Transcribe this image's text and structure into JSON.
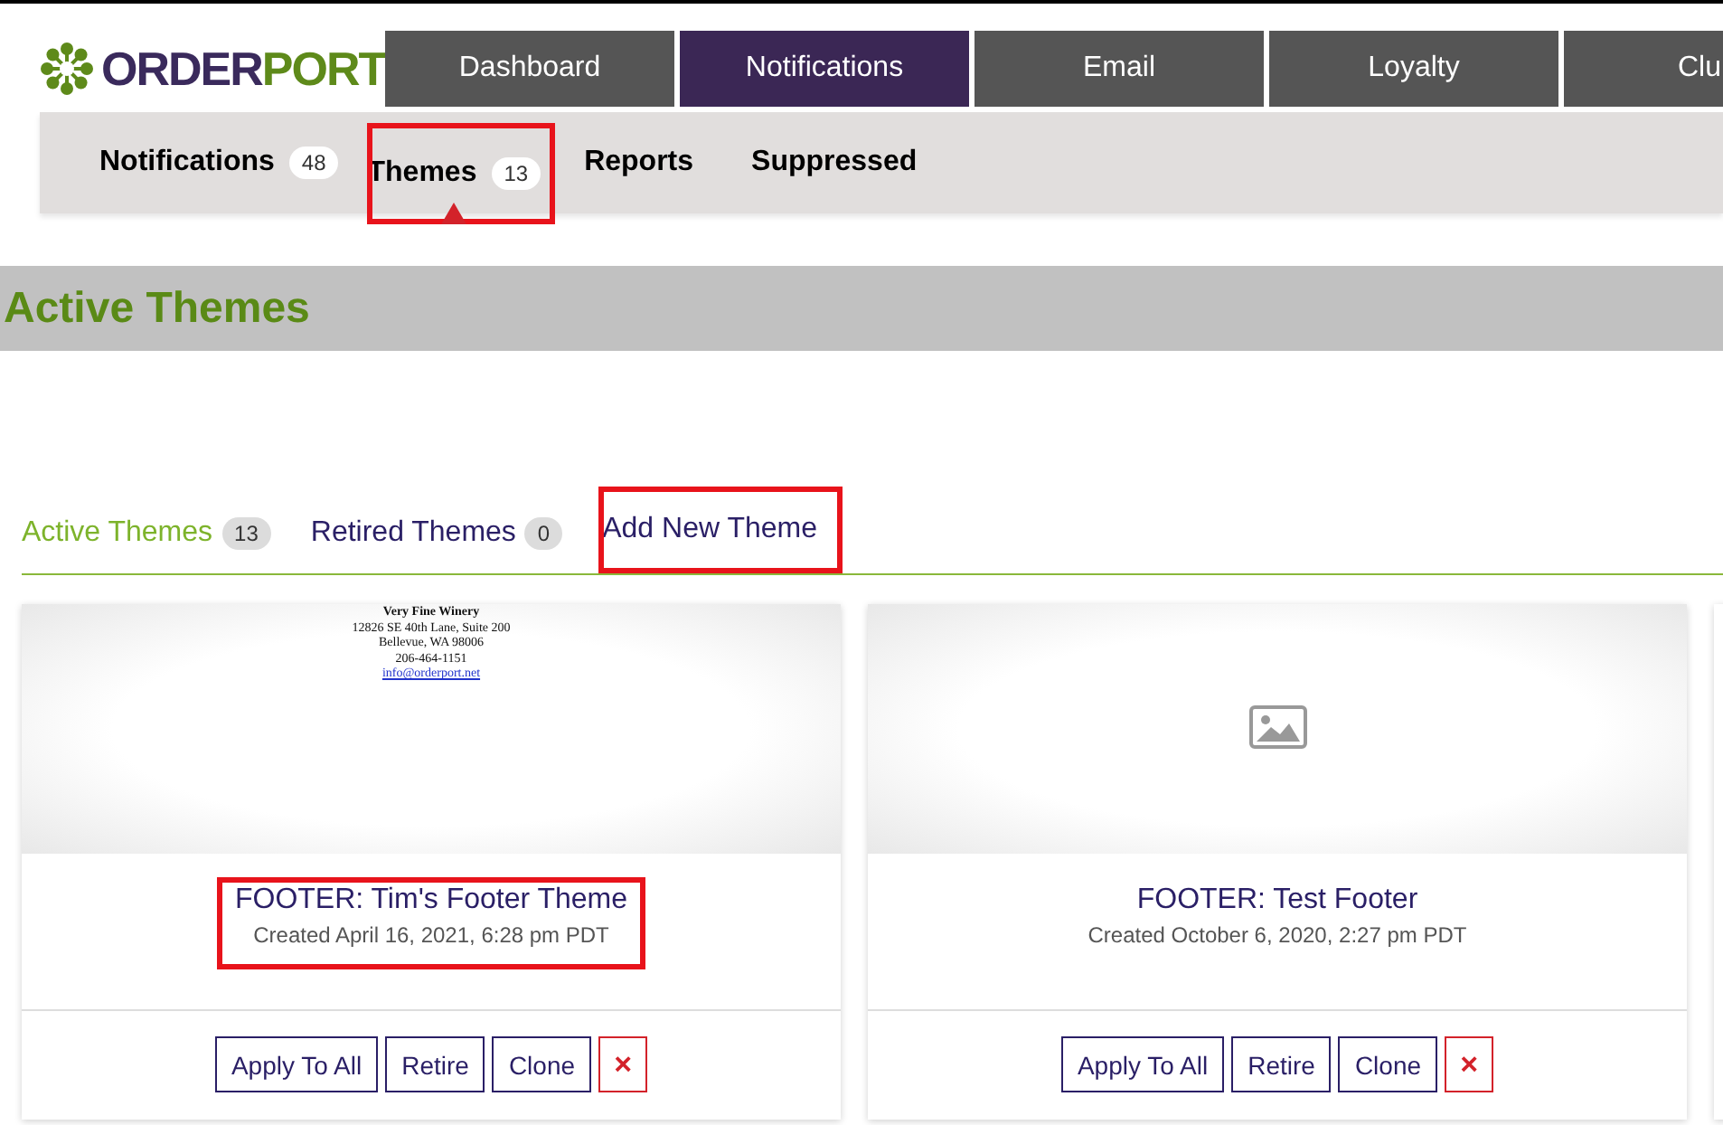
{
  "logo": {
    "part1": "ORDER",
    "part2": "PORT"
  },
  "main_nav": [
    {
      "label": "Dashboard",
      "selected": false
    },
    {
      "label": "Notifications",
      "selected": true
    },
    {
      "label": "Email",
      "selected": false
    },
    {
      "label": "Loyalty",
      "selected": false
    },
    {
      "label": "Clu",
      "selected": false
    }
  ],
  "sub_nav": [
    {
      "label": "Notifications",
      "count": "48",
      "selected": false,
      "highlighted": false
    },
    {
      "label": "Themes",
      "count": "13",
      "selected": true,
      "highlighted": true
    },
    {
      "label": "Reports",
      "selected": false,
      "highlighted": false
    },
    {
      "label": "Suppressed",
      "selected": false,
      "highlighted": false
    }
  ],
  "page_title": "Active Themes",
  "tabs": [
    {
      "label": "Active Themes",
      "count": "13",
      "selected": true,
      "highlighted": false
    },
    {
      "label": "Retired Themes",
      "count": "0",
      "selected": false,
      "highlighted": false
    },
    {
      "label": "Add New Theme",
      "selected": false,
      "highlighted": true
    }
  ],
  "cards": [
    {
      "preview": {
        "kind": "letterhead",
        "lines": [
          "Very Fine Winery",
          "12826 SE 40th Lane, Suite 200",
          "Bellevue, WA 98006",
          "206-464-1151"
        ],
        "link": "info@orderport.net"
      },
      "title": "FOOTER: Tim's Footer Theme",
      "created": "Created April 16, 2021, 6:28 pm PDT",
      "highlighted": true,
      "buttons": [
        "Apply To All",
        "Retire",
        "Clone"
      ],
      "delete": "×"
    },
    {
      "preview": {
        "kind": "placeholder"
      },
      "title": "FOOTER: Test Footer",
      "created": "Created October 6, 2020, 2:27 pm PDT",
      "highlighted": false,
      "buttons": [
        "Apply To All",
        "Retire",
        "Clone"
      ],
      "delete": "×"
    }
  ]
}
